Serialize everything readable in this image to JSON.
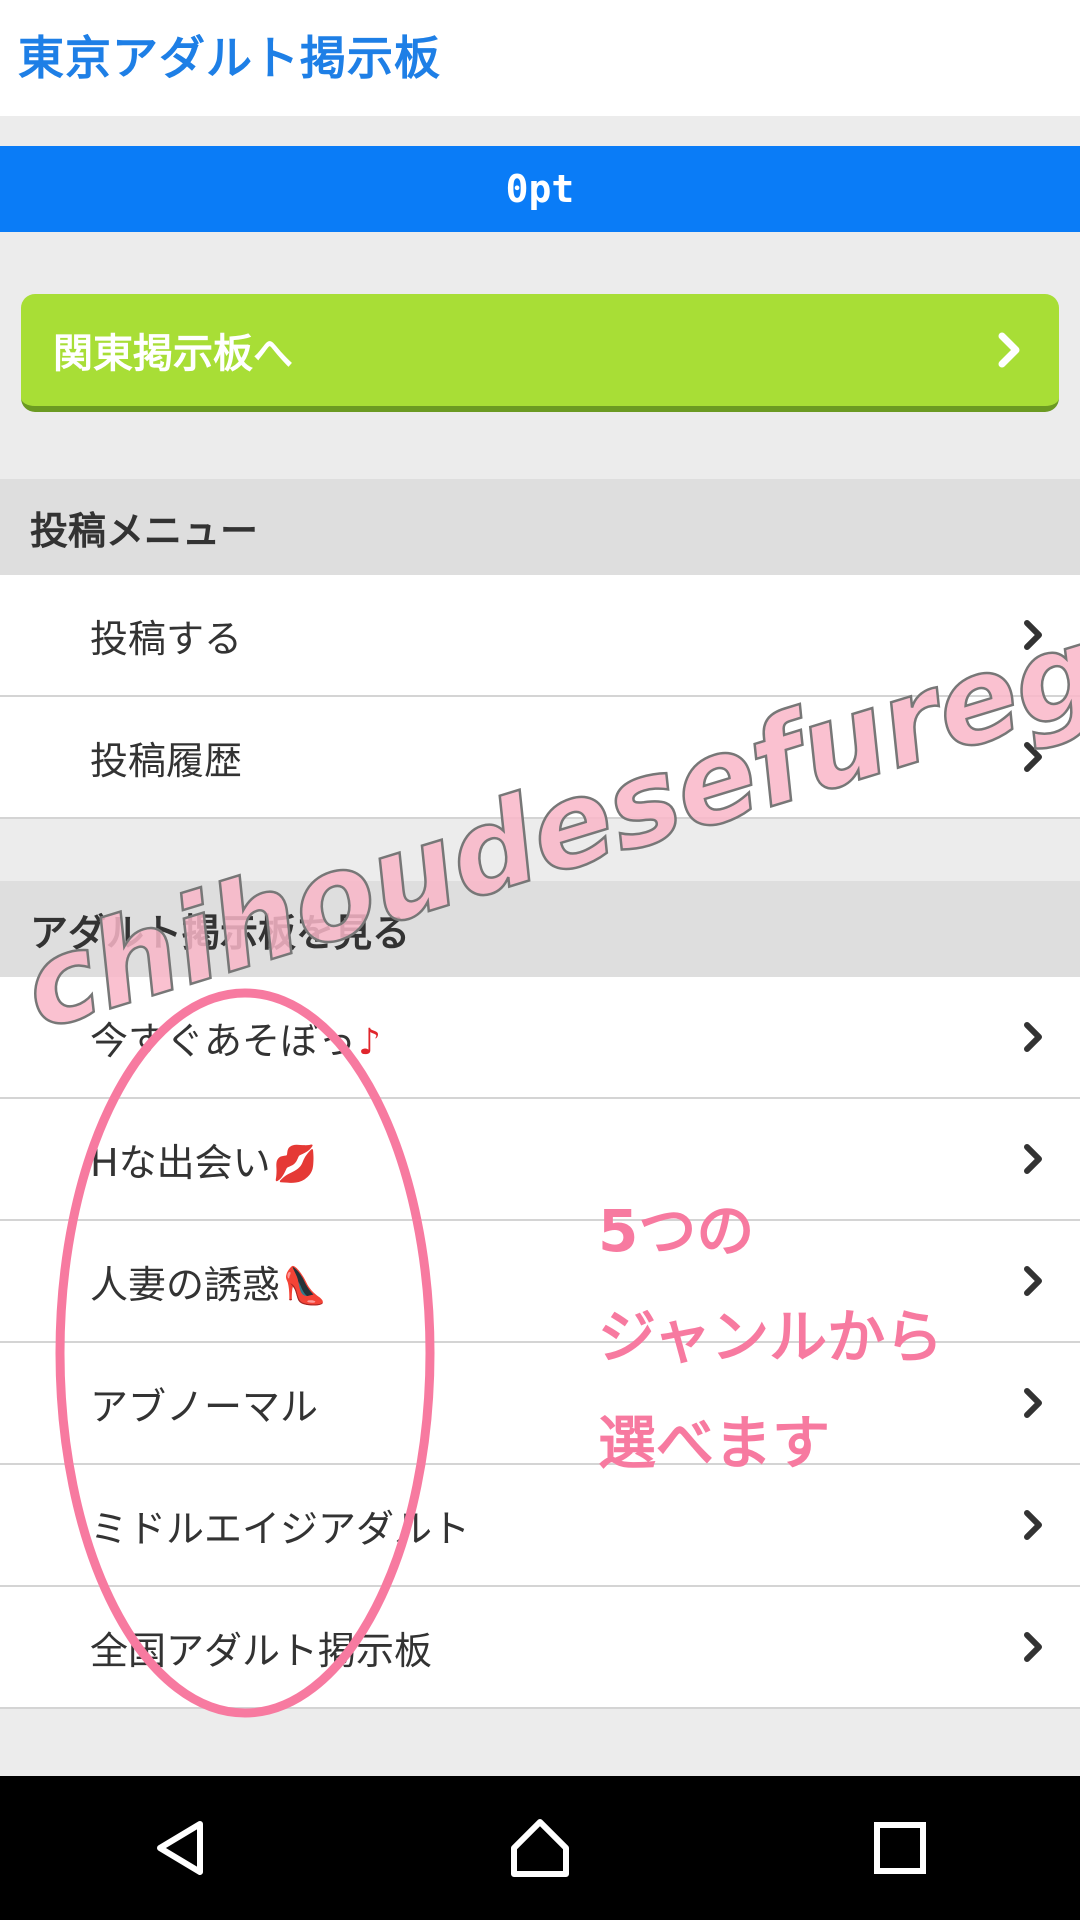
{
  "header": {
    "title": "東京アダルト掲示板"
  },
  "points": {
    "label": "0pt"
  },
  "kanto_button": {
    "label": "関東掲示板へ"
  },
  "post_menu": {
    "title": "投稿メニュー",
    "items": [
      {
        "label": "投稿する"
      },
      {
        "label": "投稿履歴"
      }
    ]
  },
  "adult_board": {
    "title": "アダルト掲示板を見る",
    "items": [
      {
        "label": "今すぐあそぼっ",
        "emoji": "♪"
      },
      {
        "label": "Hな出会い",
        "emoji": "💋"
      },
      {
        "label": "人妻の誘惑",
        "emoji": "👠"
      },
      {
        "label": "アブノーマル",
        "emoji": ""
      },
      {
        "label": "ミドルエイジアダルト",
        "emoji": ""
      },
      {
        "label": "全国アダルト掲示板",
        "emoji": ""
      }
    ]
  },
  "annotation": {
    "lines": [
      "5つの",
      "ジャンルから",
      "選べます"
    ]
  },
  "watermark": {
    "text": "chihoudesefureget.net"
  },
  "colors": {
    "title_blue": "#1e7fe6",
    "points_bar": "#0a7cf7",
    "kanto_green": "#a8de36",
    "annotation_pink": "#f77aa0"
  },
  "icons": [
    "chevron-right-icon",
    "back-icon",
    "home-icon",
    "recents-icon"
  ]
}
